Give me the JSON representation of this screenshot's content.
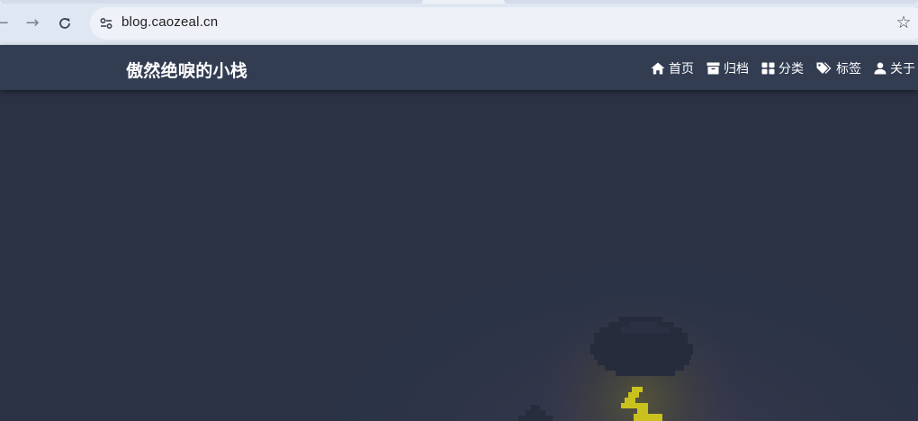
{
  "browser": {
    "url": "blog.caozeal.cn",
    "icons": {
      "back": "arrow-left-icon",
      "forward": "arrow-right-icon",
      "reload": "reload-icon",
      "site_info": "tune-icon",
      "bookmark": "star-outline-icon"
    }
  },
  "site": {
    "brand": "傲然绝唳的小栈",
    "nav": [
      {
        "label": "首页",
        "icon": "home-icon"
      },
      {
        "label": "归档",
        "icon": "archive-icon"
      },
      {
        "label": "分类",
        "icon": "grid-icon"
      },
      {
        "label": "标签",
        "icon": "tags-icon"
      },
      {
        "label": "关于",
        "icon": "user-icon"
      }
    ]
  },
  "colors": {
    "chrome_bg": "#dfe7f2",
    "navbar_bg": "#323d52",
    "hero_bg": "#2a3345",
    "lightning": "#c9c21e"
  }
}
